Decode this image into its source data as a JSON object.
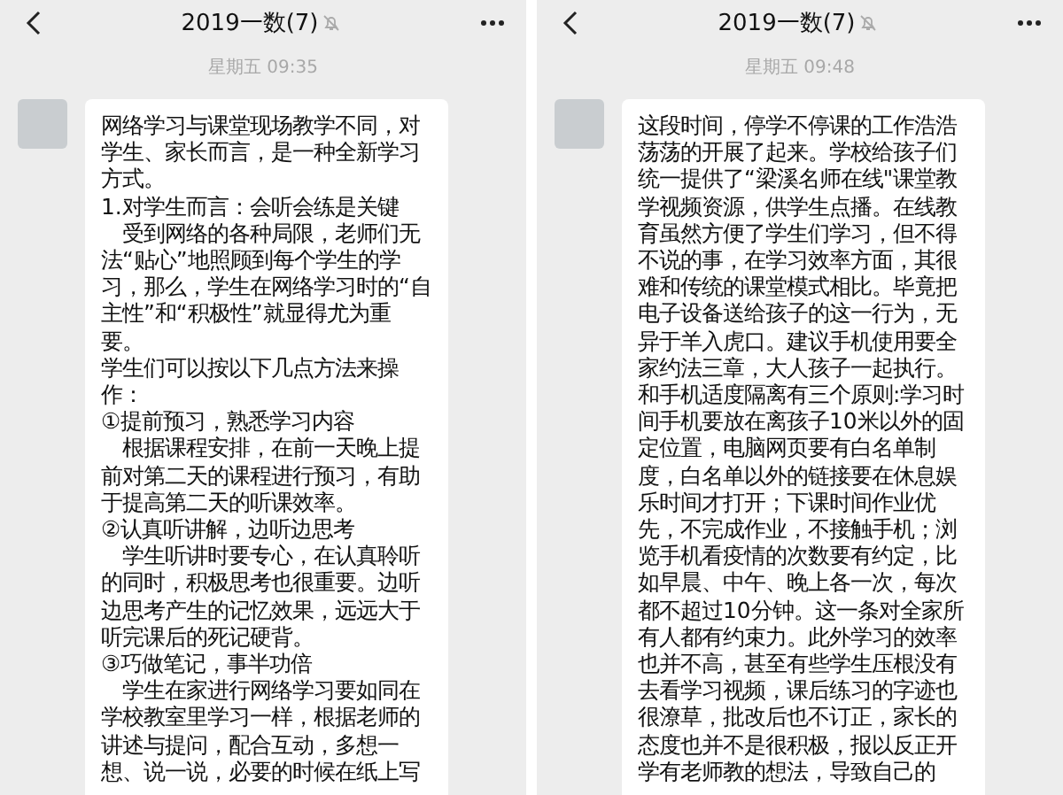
{
  "panels": [
    {
      "title": "2019一数(7)",
      "timestamp": "星期五 09:35",
      "messages": [
        {
          "paragraphs": [
            "网络学习与课堂现场教学不同，对学生、家长而言，是一种全新学习方式。",
            "1.对学生而言：会听会练是关键",
            "　受到网络的各种局限，老师们无法“贴心”地照顾到每个学生的学习，那么，学生在网络学习时的“自主性”和“积极性”就显得尤为重要。",
            "学生们可以按以下几点方法来操作：",
            "①提前预习，熟悉学习内容",
            "　根据课程安排，在前一天晚上提前对第二天的课程进行预习，有助于提高第二天的听课效率。",
            "②认真听讲解，边听边思考",
            "　学生听讲时要专心，在认真聆听的同时，积极思考也很重要。边听边思考产生的记忆效果，远远大于听完课后的死记硬背。",
            "③巧做笔记，事半功倍",
            "　学生在家进行网络学习要如同在学校教室里学习一样，根据老师的讲述与提问，配合互动，多想一想、说一说，必要的时候在纸上写"
          ]
        }
      ]
    },
    {
      "title": "2019一数(7)",
      "timestamp": "星期五 09:48",
      "messages": [
        {
          "paragraphs": [
            "这段时间，停学不停课的工作浩浩荡荡的开展了起来。学校给孩子们统一提供了“梁溪名师在线\"课堂教学视频资源，供学生点播。在线教育虽然方便了学生们学习，但不得不说的事，在学习效率方面，其很难和传统的课堂模式相比。毕竟把电子设备送给孩子的这一行为，无异于羊入虎口。建议手机使用要全家约法三章，大人孩子一起执行。",
            "和手机适度隔离有三个原则:学习时间手机要放在离孩子10米以外的固定位置，电脑网页要有白名单制度，白名单以外的链接要在休息娱乐时间才打开；下课时间作业优先，不完成作业，不接触手机；浏览手机看疫情的次数要有约定，比如早晨、中午、晚上各一次，每次都不超过10分钟。这一条对全家所有人都有约束力。此外学习的效率也并不高，甚至有些学生压根没有去看学习视频，课后练习的字迹也很潦草，批改后也不订正，家长的态度也并不是很积极，报以反正开学有老师教的想法，导致自己的"
          ]
        }
      ]
    }
  ]
}
